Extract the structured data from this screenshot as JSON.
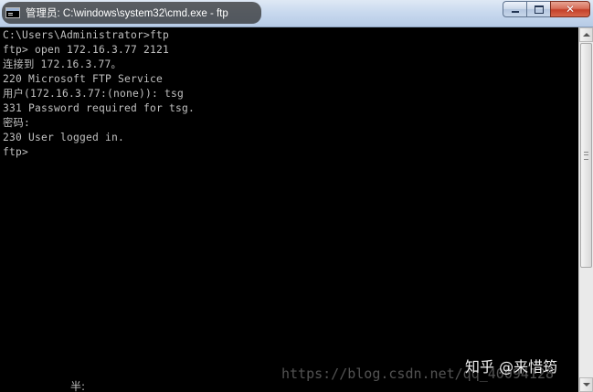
{
  "window": {
    "title": "管理员: C:\\windows\\system32\\cmd.exe - ftp",
    "controls": {
      "minimize": "minimize-icon",
      "maximize": "maximize-icon",
      "close": "✕"
    }
  },
  "console": {
    "lines": [
      "C:\\Users\\Administrator>ftp",
      "ftp> open 172.16.3.77 2121",
      "连接到 172.16.3.77。",
      "220 Microsoft FTP Service",
      "用户(172.16.3.77:(none)): tsg",
      "331 Password required for tsg.",
      "密码:",
      "230 User logged in.",
      "ftp>"
    ],
    "ime_status": "半:"
  },
  "watermarks": {
    "zhihu": "知乎 @来惜筠",
    "csdn": "https://blog.csdn.net/qq_40094128"
  },
  "colors": {
    "console_text": "#c0c0c0",
    "console_bg": "#000000",
    "close_button": "#c4412a"
  }
}
